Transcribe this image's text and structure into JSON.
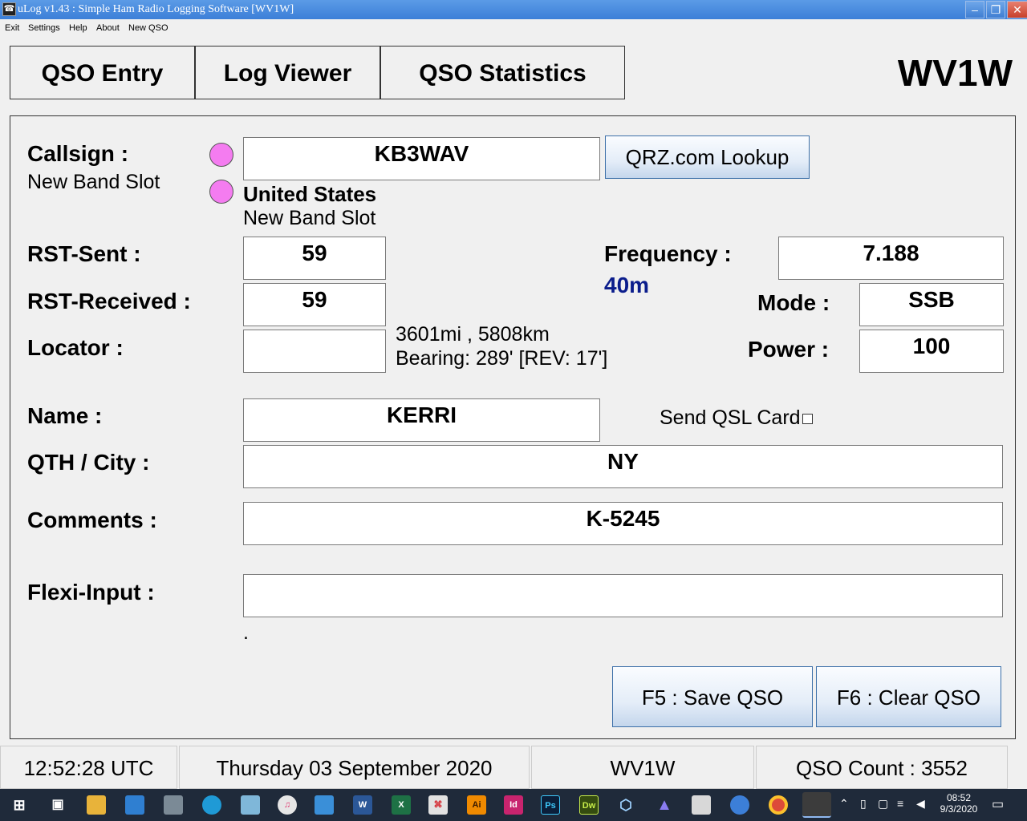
{
  "window": {
    "title": "uLog v1.43 : Simple Ham Radio Logging Software     [WV1W]",
    "icon_label": "☎",
    "controls": {
      "minimize": "‒",
      "maximize": "❐",
      "close": "✕"
    }
  },
  "menu": [
    "Exit",
    "Settings",
    "Help",
    "About",
    "New QSO"
  ],
  "tabs": [
    "QSO Entry",
    "Log Viewer",
    "QSO Statistics"
  ],
  "station_callsign": "WV1W",
  "form": {
    "callsign": {
      "label": "Callsign :",
      "status": "New Band Slot",
      "value": "KB3WAV"
    },
    "lookup_button": "QRZ.com Lookup",
    "country": {
      "name": "United States",
      "status": "New Band Slot"
    },
    "rst_sent": {
      "label": "RST-Sent :",
      "value": "59"
    },
    "rst_received": {
      "label": "RST-Received :",
      "value": "59"
    },
    "locator": {
      "label": "Locator  :",
      "value": ""
    },
    "distance": "3601mi , 5808km",
    "bearing": "Bearing: 289' [REV: 17']",
    "frequency": {
      "label": "Frequency :",
      "value": "7.188",
      "band": "40m"
    },
    "mode": {
      "label": "Mode :",
      "value": "SSB"
    },
    "power": {
      "label": "Power :",
      "value": "100"
    },
    "name": {
      "label": "Name :",
      "value": "KERRI"
    },
    "send_qsl": {
      "label": "Send QSL Card",
      "checked": false
    },
    "qth": {
      "label": "QTH / City :",
      "value": "NY"
    },
    "comments": {
      "label": "Comments  :",
      "value": "K-5245"
    },
    "flexi": {
      "label": "Flexi-Input :",
      "value": "",
      "hint": "."
    },
    "indicator_color": "#f47cf0"
  },
  "actions": {
    "save": "F5 : Save QSO",
    "clear": "F6 : Clear QSO"
  },
  "statusbar": {
    "time": "12:52:28  UTC",
    "date": "Thursday 03 September 2020",
    "station": "WV1W",
    "qso_count": "QSO Count : 3552"
  },
  "taskbar": {
    "apps": [
      "start-icon",
      "task-view-icon",
      "file-explorer-icon",
      "contacts-icon",
      "calculator-icon",
      "edge-icon",
      "notes-icon",
      "itunes-icon",
      "network-icon",
      "word-icon",
      "excel-icon",
      "acrobat-icon",
      "illustrator-icon",
      "indesign-icon",
      "photoshop-icon",
      "dreamweaver-icon",
      "virtualbox-icon",
      "vlc-icon",
      "calendar-icon",
      "chat-icon",
      "chrome-icon",
      "ulog-icon"
    ],
    "app_labels": {
      "illustrator": "Ai",
      "indesign": "Id",
      "photoshop": "Ps",
      "dreamweaver": "Dw",
      "word": "W",
      "excel": "X"
    },
    "clock_time": "08:52",
    "clock_date": "9/3/2020"
  }
}
